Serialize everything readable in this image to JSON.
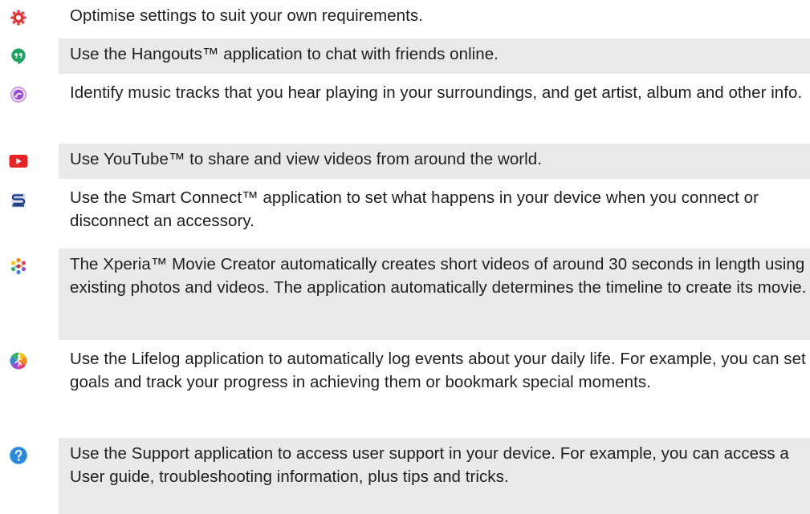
{
  "apps": [
    {
      "icon": "settings-icon",
      "description": "Optimise settings to suit your own requirements."
    },
    {
      "icon": "hangouts-icon",
      "description": "Use the Hangouts™ application to chat with friends online."
    },
    {
      "icon": "trackid-icon",
      "description": "Identify music tracks that you hear playing in your surroundings, and get artist, album and other info."
    },
    {
      "icon": "youtube-icon",
      "description": "Use YouTube™ to share and view videos from around the world."
    },
    {
      "icon": "smart-connect-icon",
      "description": "Use the Smart Connect™ application to set what happens in your device when you connect or disconnect an accessory."
    },
    {
      "icon": "movie-creator-icon",
      "description": "The Xperia™ Movie Creator automatically creates short videos of around 30 seconds in length using existing photos and videos. The application automatically determines the timeline to create its movie."
    },
    {
      "icon": "lifelog-icon",
      "description": "Use the Lifelog application to automatically log events about your daily life. For example, you can set goals and track your progress in achieving them or bookmark special moments."
    },
    {
      "icon": "support-icon",
      "description": "Use the Support application to access user support in your device. For example, you can access a User guide, troubleshooting information, plus tips and tricks."
    }
  ]
}
